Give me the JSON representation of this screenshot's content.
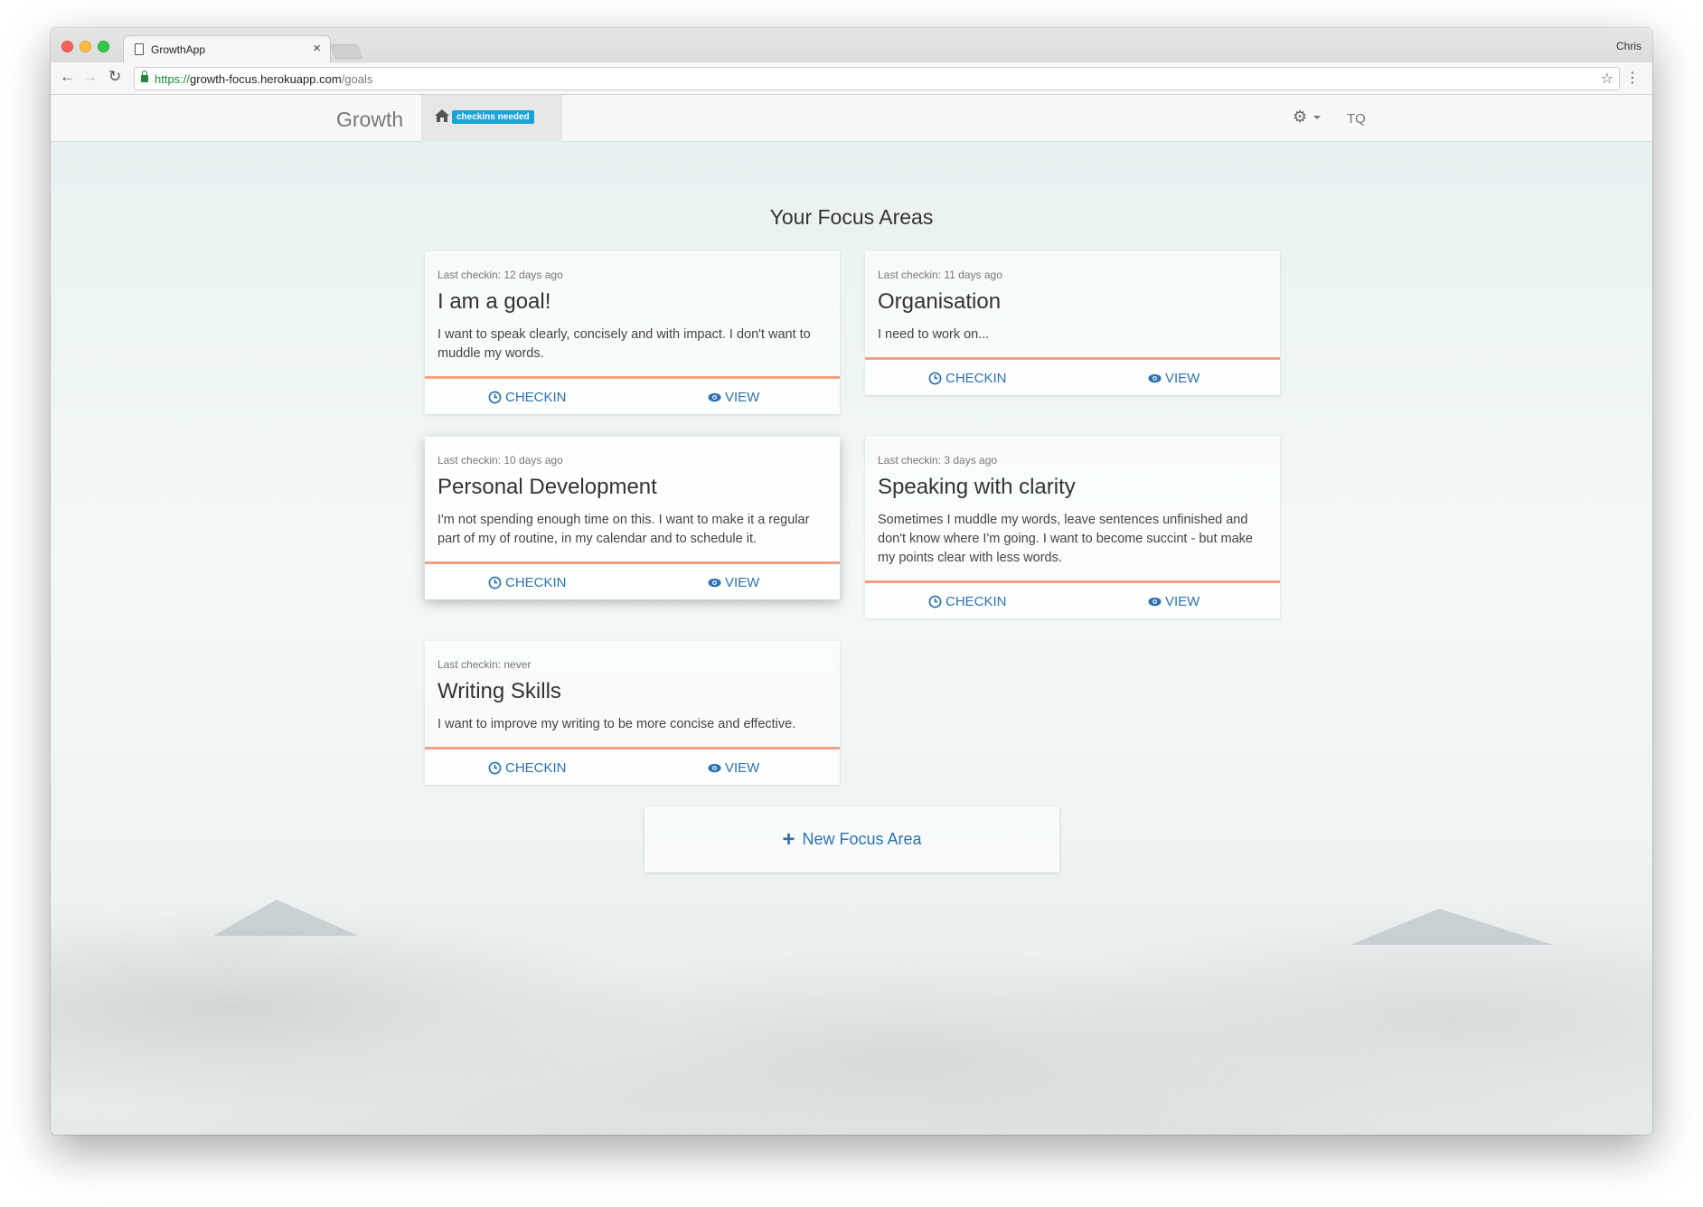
{
  "browser": {
    "tab_title": "GrowthApp",
    "profile_name": "Chris",
    "url_scheme": "https://",
    "url_host": "growth-focus.herokuapp.com",
    "url_path": "/goals"
  },
  "nav": {
    "brand": "Growth",
    "badge": "checkins needed",
    "user": "TQ"
  },
  "page_title": "Your Focus Areas",
  "actions": {
    "checkin": "CHECKIN",
    "view": "VIEW"
  },
  "goals": [
    {
      "last_checkin": "Last checkin: 12 days ago",
      "title": "I am a goal!",
      "description": "I want to speak clearly, concisely and with impact. I don't want to muddle my words."
    },
    {
      "last_checkin": "Last checkin: 11 days ago",
      "title": "Organisation",
      "description": "I need to work on..."
    },
    {
      "last_checkin": "Last checkin: 10 days ago",
      "title": "Personal Development",
      "description": "I'm not spending enough time on this. I want to make it a regular part of my of routine, in my calendar and to schedule it."
    },
    {
      "last_checkin": "Last checkin: 3 days ago",
      "title": "Speaking with clarity",
      "description": "Sometimes I muddle my words, leave sentences unfinished and don't know where I'm going. I want to become succint - but make my points clear with less words."
    },
    {
      "last_checkin": "Last checkin: never",
      "title": "Writing Skills",
      "description": "I want to improve my writing to be more concise and effective."
    }
  ],
  "new_focus_label": "New Focus Area",
  "colors": {
    "accent_line": "#f4a07f",
    "link": "#2d72b1",
    "badge": "#1ca3d8"
  }
}
